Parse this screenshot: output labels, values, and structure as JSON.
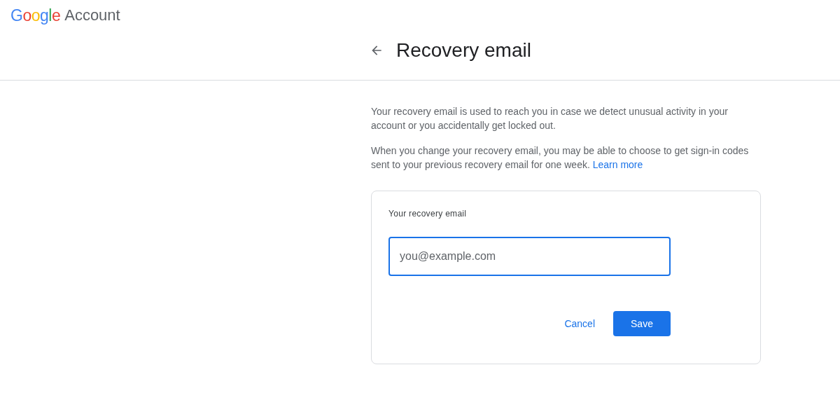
{
  "header": {
    "logo": "Google",
    "product": "Account"
  },
  "page": {
    "title": "Recovery email"
  },
  "paragraphs": [
    {
      "text": "Your recovery email is used to reach you in case we detect unusual activity in your account or you accidentally get locked out."
    },
    {
      "text": "When you change your recovery email, you may be able to choose to get sign-in codes sent to your previous recovery email for one week.",
      "link": "Learn more"
    }
  ],
  "card": {
    "label": "Your recovery email",
    "field": {
      "placeholder": "you@example.com",
      "focused": true
    },
    "buttons": [
      {
        "label": "Cancel",
        "kind": "text"
      },
      {
        "label": "Save",
        "kind": "filled"
      }
    ]
  }
}
